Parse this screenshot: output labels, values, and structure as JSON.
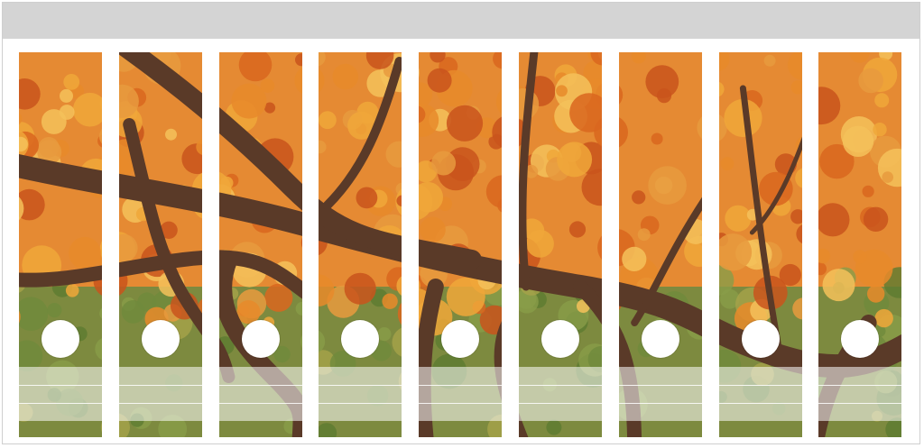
{
  "sheet": {
    "spine_count": 9,
    "photo_subject": "autumn-maple-tree",
    "colors": {
      "top_band": "#d4d4d4",
      "sheet_background": "#ffffff",
      "foliage_orange": "#e8892a",
      "foliage_gold": "#f0a73a",
      "branch_brown": "#5a3a28",
      "moss_green": "#6f8a3c"
    }
  },
  "spines": [
    {
      "id": 1
    },
    {
      "id": 2
    },
    {
      "id": 3
    },
    {
      "id": 4
    },
    {
      "id": 5
    },
    {
      "id": 6
    },
    {
      "id": 7
    },
    {
      "id": 8
    },
    {
      "id": 9
    }
  ]
}
